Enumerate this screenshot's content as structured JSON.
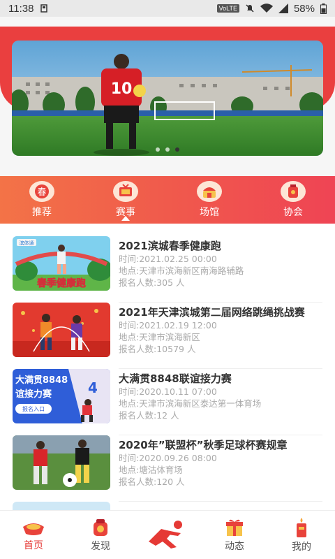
{
  "status_bar": {
    "time": "11:38",
    "network": "VoLTE",
    "battery": "58%"
  },
  "categories": [
    {
      "label": "推荐",
      "icon": "recommend-icon"
    },
    {
      "label": "赛事",
      "icon": "event-icon",
      "active": true
    },
    {
      "label": "场馆",
      "icon": "venue-icon"
    },
    {
      "label": "协会",
      "icon": "association-icon"
    }
  ],
  "events": [
    {
      "title": "2021滨城春季健康跑",
      "time": "时间:2021.02.25 00:00",
      "location": "地点:天津市滨海新区南海路辅路",
      "signups": "报名人数:305 人",
      "thumb_text": "春季健康跑",
      "thumb_tag": "滨体通"
    },
    {
      "title": "2021年天津滨城第二届网络跳绳挑战赛",
      "time": "时间:2021.02.19 12:00",
      "location": "地点:天津市滨海新区",
      "signups": "报名人数:10579 人"
    },
    {
      "title": "大满贯8848联谊接力赛",
      "time": "时间:2020.10.11 07:00",
      "location": "地点:天津市滨海新区泰达第一体育场",
      "signups": "报名人数:12 人",
      "thumb_text": "大满贯8848",
      "thumb_sub": "谊接力赛",
      "thumb_btn": "报名入口"
    },
    {
      "title": "2020年”联盟杯”秋季足球杯赛规章",
      "time": "时间:2020.09.26 08:00",
      "location": "地点:塘沽体育场",
      "signups": "报名人数:120 人"
    }
  ],
  "bottom_nav": [
    {
      "label": "首页",
      "icon": "home-icon",
      "active": true
    },
    {
      "label": "发现",
      "icon": "discover-icon"
    },
    {
      "label": "",
      "icon": "runner-logo-icon"
    },
    {
      "label": "动态",
      "icon": "gift-icon"
    },
    {
      "label": "我的",
      "icon": "profile-icon"
    }
  ],
  "colors": {
    "accent": "#ea3f3f",
    "active_text": "#e53935"
  }
}
